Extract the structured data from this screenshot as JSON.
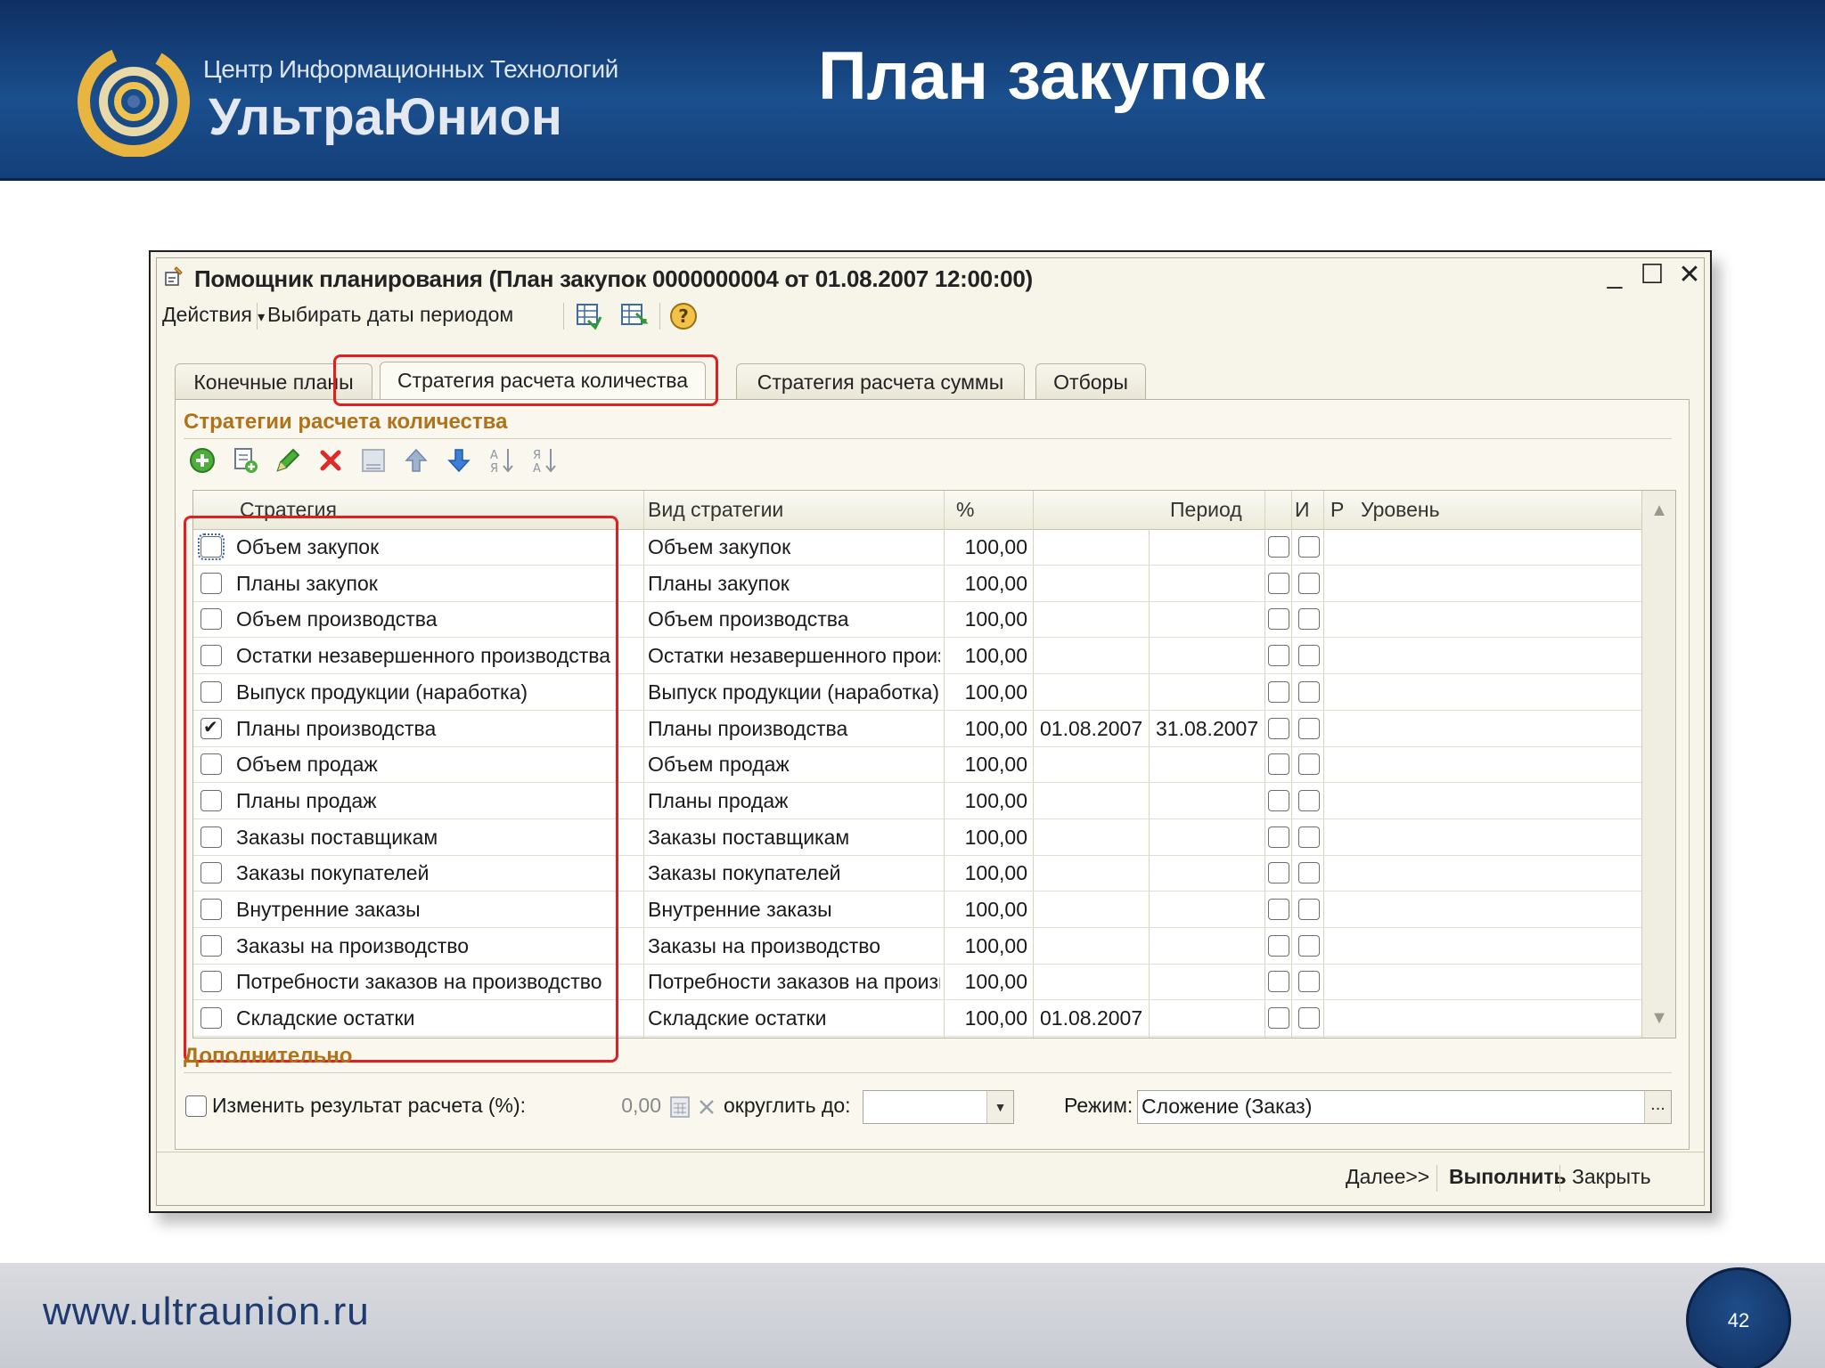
{
  "slide": {
    "title": "План закупок",
    "company_line1": "Центр Информационных Технологий",
    "company_line2": "УльтраЮнион",
    "footer_url": "www.ultraunion.ru",
    "page_number": "42"
  },
  "window": {
    "title": "Помощник планирования (План закупок 0000000004 от 01.08.2007 12:00:00)",
    "minimize_glyph": "_",
    "maximize_glyph": "☐",
    "close_glyph": "✕",
    "menu": {
      "actions": "Действия",
      "actions_arrow": "▾",
      "choose_dates": "Выбирать даты периодом"
    },
    "tabs": [
      {
        "label": "Конечные планы",
        "active": false
      },
      {
        "label": "Стратегия расчета количества",
        "active": true
      },
      {
        "label": "Стратегия расчета суммы",
        "active": false
      },
      {
        "label": "Отборы",
        "active": false
      }
    ],
    "section_strategies": "Стратегии расчета количества",
    "grid": {
      "headers": {
        "strategy": "Стратегия",
        "type": "Вид стратегии",
        "percent": "%",
        "period": "Период",
        "i": "И",
        "r": "Р",
        "level": "Уровень"
      },
      "rows": [
        {
          "checked": false,
          "strategy": "Объем закупок",
          "type": "Объем закупок",
          "percent": "100,00",
          "from": "",
          "to": ""
        },
        {
          "checked": false,
          "strategy": "Планы закупок",
          "type": "Планы закупок",
          "percent": "100,00",
          "from": "",
          "to": ""
        },
        {
          "checked": false,
          "strategy": "Объем производства",
          "type": "Объем производства",
          "percent": "100,00",
          "from": "",
          "to": ""
        },
        {
          "checked": false,
          "strategy": "Остатки незавершенного производства",
          "type": "Остатки незавершенного производс...",
          "percent": "100,00",
          "from": "",
          "to": ""
        },
        {
          "checked": false,
          "strategy": "Выпуск продукции (наработка)",
          "type": "Выпуск продукции (наработка)",
          "percent": "100,00",
          "from": "",
          "to": ""
        },
        {
          "checked": true,
          "strategy": "Планы производства",
          "type": "Планы производства",
          "percent": "100,00",
          "from": "01.08.2007",
          "to": "31.08.2007"
        },
        {
          "checked": false,
          "strategy": "Объем продаж",
          "type": "Объем продаж",
          "percent": "100,00",
          "from": "",
          "to": ""
        },
        {
          "checked": false,
          "strategy": "Планы продаж",
          "type": "Планы продаж",
          "percent": "100,00",
          "from": "",
          "to": ""
        },
        {
          "checked": false,
          "strategy": "Заказы поставщикам",
          "type": "Заказы поставщикам",
          "percent": "100,00",
          "from": "",
          "to": ""
        },
        {
          "checked": false,
          "strategy": "Заказы покупателей",
          "type": "Заказы покупателей",
          "percent": "100,00",
          "from": "",
          "to": ""
        },
        {
          "checked": false,
          "strategy": "Внутренние заказы",
          "type": "Внутренние заказы",
          "percent": "100,00",
          "from": "",
          "to": ""
        },
        {
          "checked": false,
          "strategy": "Заказы на производство",
          "type": "Заказы на производство",
          "percent": "100,00",
          "from": "",
          "to": ""
        },
        {
          "checked": false,
          "strategy": "Потребности заказов на производство",
          "type": "Потребности заказов на производст...",
          "percent": "100,00",
          "from": "",
          "to": ""
        },
        {
          "checked": false,
          "strategy": "Складские остатки",
          "type": "Складские остатки",
          "percent": "100,00",
          "from": "01.08.2007",
          "to": ""
        }
      ]
    },
    "section_additional": "Дополнительно",
    "additional": {
      "change_result_label": "Изменить результат расчета (%):",
      "change_result_value": "0,00",
      "round_label": "округлить до:",
      "round_value": "",
      "mode_label": "Режим:",
      "mode_value": "Сложение (Заказ)",
      "mode_button": "..."
    },
    "buttons": {
      "next": "Далее>>",
      "run": "Выполнить",
      "close": "Закрыть"
    }
  },
  "colors": {
    "header_bg": "#1a4f8d",
    "accent_orange": "#b0731a",
    "highlight_red": "#e02020",
    "window_bg": "#f6f4e9"
  }
}
